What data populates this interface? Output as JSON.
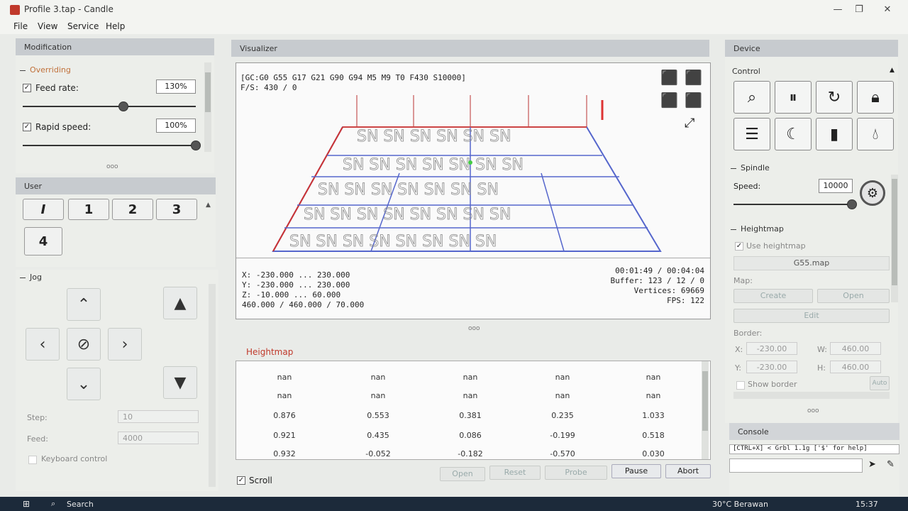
{
  "window": {
    "title": "Profile 3.tap - Candle",
    "minimize": "—",
    "maximize": "❐",
    "close": "✕"
  },
  "menu": [
    "File",
    "View",
    "Service",
    "Help"
  ],
  "modification": {
    "header": "Modification",
    "overriding_title": "Overriding",
    "feed_rate_label": "Feed rate:",
    "feed_rate_value": "130%",
    "feed_rate_level": 0.58,
    "rapid_label": "Rapid speed:",
    "rapid_value": "100%",
    "rapid_level": 1.0,
    "dots": "ooo"
  },
  "user": {
    "header": "User",
    "buttons": [
      "1",
      "2",
      "3",
      "4"
    ],
    "first_button": "I"
  },
  "jog": {
    "title": "Jog",
    "step_label": "Step:",
    "step_value": "10",
    "feed_label": "Feed:",
    "feed_value": "4000",
    "keyboard_label": "Keyboard control"
  },
  "visualizer": {
    "header": "Visualizer",
    "gcode_state": "[GC:G0 G55 G17 G21 G90 G94 M5 M9 T0 F430 S10000]",
    "fs": "F/S: 430 / 0",
    "x_range": "X: -230.000 ... 230.000",
    "y_range": "Y: -230.000 ... 230.000",
    "z_range": "Z: -10.000 ... 60.000",
    "size": "460.000 / 460.000 / 70.000",
    "time": "00:01:49 / 00:04:04",
    "buffer": "Buffer: 123 / 12 / 0",
    "vertices": "Vertices: 69669",
    "fps": "FPS: 122",
    "dots": "ooo"
  },
  "heightmap": {
    "title": "Heightmap",
    "rows": [
      [
        "nan",
        "nan",
        "nan",
        "nan",
        "nan"
      ],
      [
        "nan",
        "nan",
        "nan",
        "nan",
        "nan"
      ],
      [
        "0.876",
        "0.553",
        "0.381",
        "0.235",
        "1.033"
      ],
      [
        "0.921",
        "0.435",
        "0.086",
        "-0.199",
        "0.518"
      ],
      [
        "0.932",
        "-0.052",
        "-0.182",
        "-0.570",
        "0.030"
      ]
    ]
  },
  "bottom": {
    "scroll_label": "Scroll",
    "open": "Open",
    "reset": "Reset",
    "probe": "Probe",
    "pause": "Pause",
    "abort": "Abort"
  },
  "device": {
    "header": "Device",
    "control_title": "Control",
    "spindle_title": "Spindle",
    "speed_label": "Speed:",
    "speed_value": "10000",
    "speed_level": 0.98,
    "heightmap_title": "Heightmap",
    "use_heightmap": "Use heightmap",
    "map_file": "G55.map",
    "map_label": "Map:",
    "create": "Create",
    "open": "Open",
    "edit": "Edit",
    "border_label": "Border:",
    "x_label": "X:",
    "x_value": "-230.00",
    "w_label": "W:",
    "w_value": "460.00",
    "y_label": "Y:",
    "y_value": "-230.00",
    "h_label": "H:",
    "h_value": "460.00",
    "show_border": "Show border",
    "auto": "Auto",
    "dots": "ooo"
  },
  "console": {
    "header": "Console",
    "line": "[CTRL+X] < Grbl 1.1g ['$' for help]"
  },
  "taskbar": {
    "search": "Search",
    "weather": "30°C  Berawan",
    "time": "15:37"
  }
}
